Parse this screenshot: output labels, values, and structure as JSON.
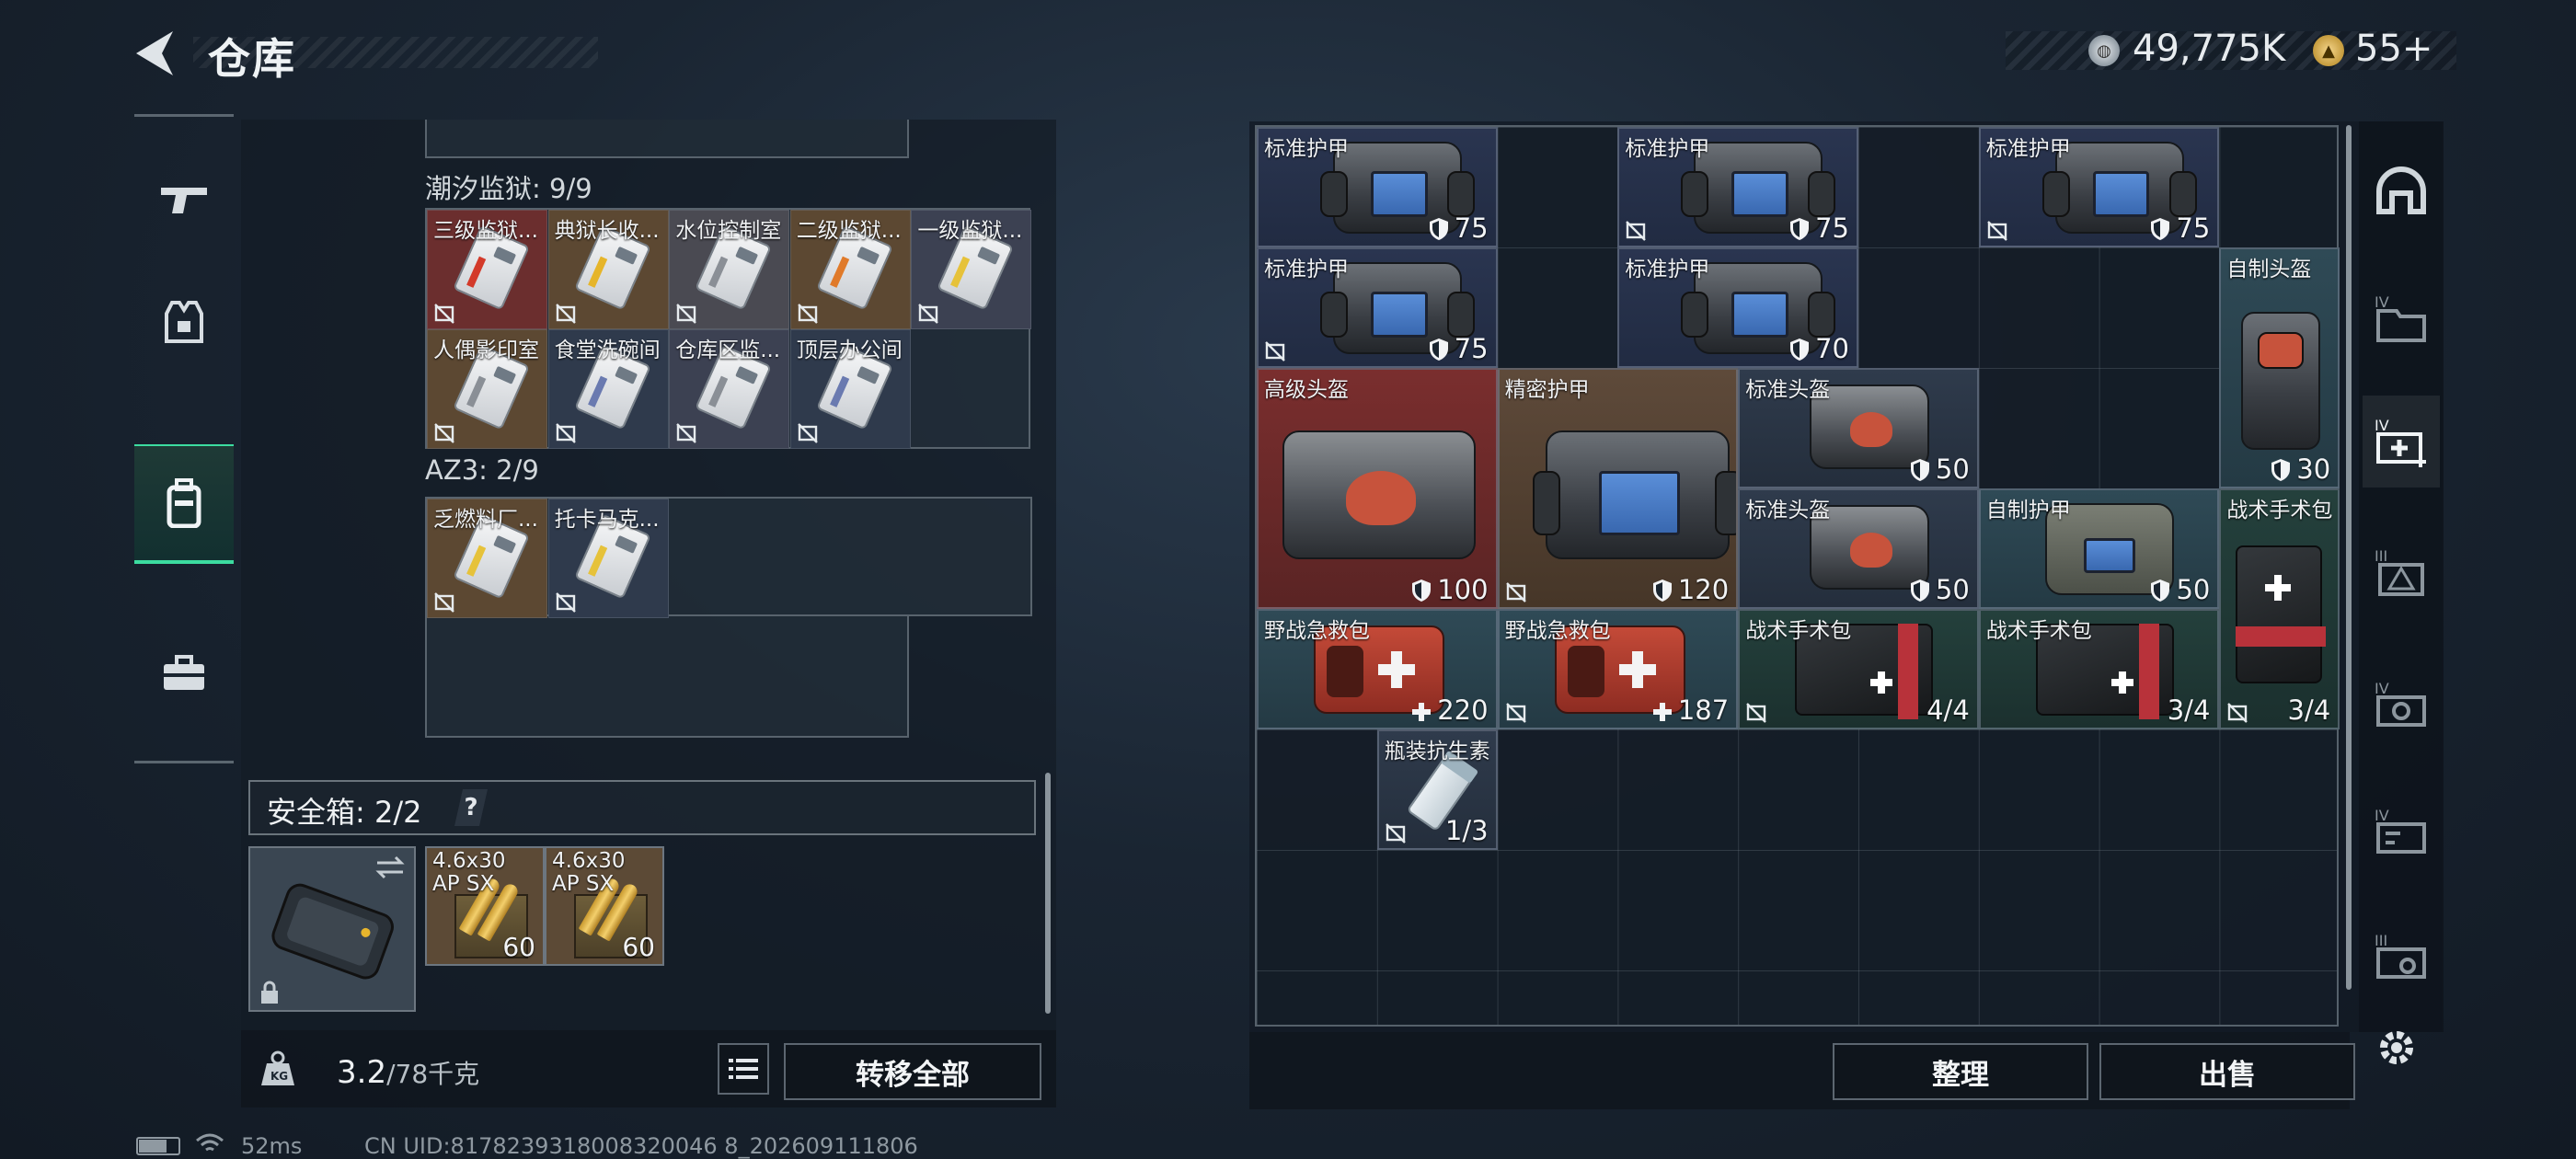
{
  "header": {
    "title": "仓库",
    "silver": "49,775K",
    "gold": "55+"
  },
  "nav": {
    "items": [
      "weapons",
      "equipment",
      "backpack",
      "toolbox"
    ],
    "active": "backpack"
  },
  "left": {
    "sections": [
      {
        "label": "潮汐监狱: 9/9",
        "cells": [
          {
            "name": "三级监狱...",
            "bg": "#6b2e2e",
            "stripe": "#d33a2a"
          },
          {
            "name": "典狱长收...",
            "bg": "#5c4832",
            "stripe": "#e6b52a"
          },
          {
            "name": "水位控制室",
            "bg": "#4a4a52",
            "stripe": "#8a8f96"
          },
          {
            "name": "二级监狱...",
            "bg": "#5c4832",
            "stripe": "#e07a2a"
          },
          {
            "name": "一级监狱...",
            "bg": "#3c4152",
            "stripe": "#e6c23a"
          },
          {
            "name": "人偶影印室",
            "bg": "#5c4832",
            "stripe": "#8a8f96"
          },
          {
            "name": "食堂洗碗间",
            "bg": "#2f3a4c",
            "stripe": "#6a7ab0"
          },
          {
            "name": "仓库区监...",
            "bg": "#3c4152",
            "stripe": "#8a8f96"
          },
          {
            "name": "顶层办公间",
            "bg": "#2f3a4c",
            "stripe": "#6a7ab0"
          }
        ]
      },
      {
        "label": "AZ3: 2/9",
        "cells": [
          {
            "name": "乏燃料厂...",
            "bg": "#5c4832",
            "stripe": "#e6c23a"
          },
          {
            "name": "托卡马克...",
            "bg": "#2f3a4c",
            "stripe": "#e6c23a"
          }
        ]
      }
    ],
    "safe_box": {
      "label": "安全箱: 2/2",
      "help": "?",
      "ammo": [
        {
          "name": "4.6x30 AP SX",
          "qty": "60"
        },
        {
          "name": "4.6x30 AP SX",
          "qty": "60"
        }
      ]
    },
    "weight": {
      "current": "3.2",
      "max": "/78千克"
    },
    "transfer_label": "转移全部"
  },
  "right": {
    "items": [
      {
        "name": "标准护甲",
        "qty": "75",
        "type": "vest",
        "bg": "bg-blue",
        "col": 0,
        "row": 0,
        "w": 2,
        "h": 1,
        "icon": "armor",
        "lock": false
      },
      {
        "name": "标准护甲",
        "qty": "75",
        "type": "vest",
        "bg": "bg-blue",
        "col": 3,
        "row": 0,
        "w": 2,
        "h": 1,
        "icon": "armor",
        "lock": true
      },
      {
        "name": "标准护甲",
        "qty": "75",
        "type": "vest",
        "bg": "bg-blue",
        "col": 6,
        "row": 0,
        "w": 2,
        "h": 1,
        "icon": "armor",
        "lock": true
      },
      {
        "name": "标准护甲",
        "qty": "75",
        "type": "vest",
        "bg": "bg-blue",
        "col": 0,
        "row": 1,
        "w": 2,
        "h": 1,
        "icon": "armor",
        "lock": true
      },
      {
        "name": "标准护甲",
        "qty": "70",
        "type": "vest",
        "bg": "bg-blue",
        "col": 3,
        "row": 1,
        "w": 2,
        "h": 1,
        "icon": "armor",
        "lock": false
      },
      {
        "name": "自制头盔",
        "qty": "30",
        "type": "helmet-tall",
        "bg": "bg-teal",
        "col": 8,
        "row": 1,
        "w": 1,
        "h": 2,
        "icon": "armor",
        "lock": false
      },
      {
        "name": "高级头盔",
        "qty": "100",
        "type": "helmet-big",
        "bg": "bg-red",
        "col": 0,
        "row": 2,
        "w": 2,
        "h": 2,
        "icon": "armor",
        "lock": false
      },
      {
        "name": "精密护甲",
        "qty": "120",
        "type": "vest-big",
        "bg": "bg-brown",
        "col": 2,
        "row": 2,
        "w": 2,
        "h": 2,
        "icon": "armor",
        "lock": true
      },
      {
        "name": "标准头盔",
        "qty": "50",
        "type": "helmet",
        "bg": "bg-slate",
        "col": 4,
        "row": 2,
        "w": 2,
        "h": 1,
        "icon": "armor",
        "lock": false
      },
      {
        "name": "标准头盔",
        "qty": "50",
        "type": "helmet",
        "bg": "bg-slate",
        "col": 4,
        "row": 3,
        "w": 2,
        "h": 1,
        "icon": "armor",
        "lock": false
      },
      {
        "name": "自制护甲",
        "qty": "50",
        "type": "vest-homemade",
        "bg": "bg-teal",
        "col": 6,
        "row": 3,
        "w": 2,
        "h": 1,
        "icon": "armor",
        "lock": false
      },
      {
        "name": "战术手术包",
        "qty": "3/4",
        "type": "tactical-tall",
        "bg": "bg-green",
        "col": 8,
        "row": 3,
        "w": 1,
        "h": 2,
        "icon": "none",
        "lock": true
      },
      {
        "name": "野战急救包",
        "qty": "220",
        "type": "medkit",
        "bg": "bg-teal",
        "col": 0,
        "row": 4,
        "w": 2,
        "h": 1,
        "icon": "plus",
        "lock": false
      },
      {
        "name": "野战急救包",
        "qty": "187",
        "type": "medkit",
        "bg": "bg-teal",
        "col": 2,
        "row": 4,
        "w": 2,
        "h": 1,
        "icon": "plus",
        "lock": true
      },
      {
        "name": "战术手术包",
        "qty": "4/4",
        "type": "tactical",
        "bg": "bg-green",
        "col": 4,
        "row": 4,
        "w": 2,
        "h": 1,
        "icon": "none",
        "lock": true
      },
      {
        "name": "战术手术包",
        "qty": "3/4",
        "type": "tactical",
        "bg": "bg-green",
        "col": 6,
        "row": 4,
        "w": 2,
        "h": 1,
        "icon": "none",
        "lock": false
      },
      {
        "name": "瓶装抗生素",
        "qty": "1/3",
        "type": "vial",
        "bg": "bg-slate",
        "col": 1,
        "row": 5,
        "w": 1,
        "h": 1,
        "icon": "none",
        "lock": true
      }
    ],
    "sort_label": "整理",
    "sell_label": "出售"
  },
  "status": {
    "ping": "52ms",
    "uid": "CN UID:8178239318008320046 8_202609111806"
  },
  "colors": {
    "accent": "#3cdca0",
    "border": "#5c6670"
  }
}
